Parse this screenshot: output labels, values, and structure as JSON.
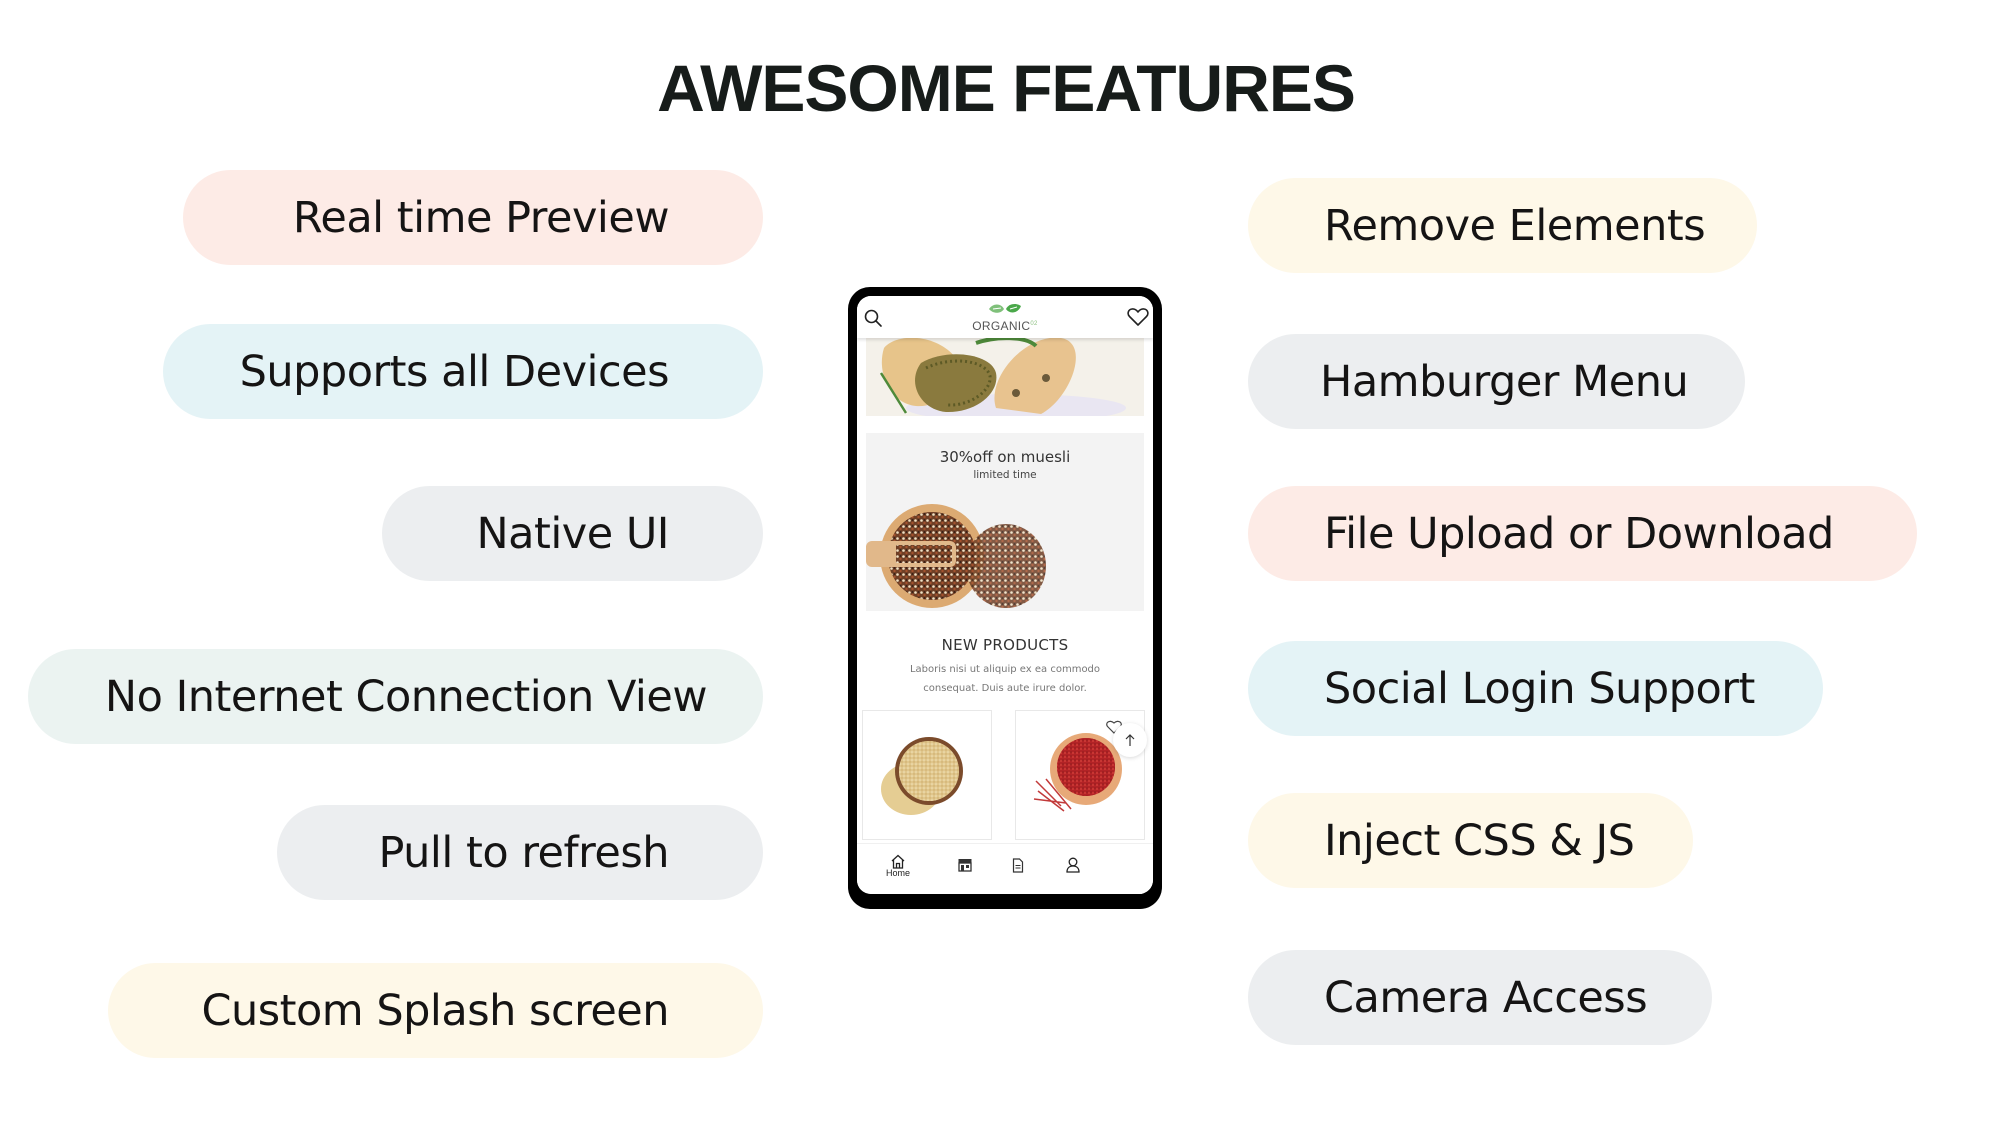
{
  "page": {
    "title": "AWESOME FEATURES"
  },
  "features_left": [
    {
      "label": "Real time Preview",
      "color": "#fdebe6"
    },
    {
      "label": "Supports all Devices",
      "color": "#e4f3f6"
    },
    {
      "label": "Native UI",
      "color": "#eceef0"
    },
    {
      "label": "No Internet Connection View",
      "color": "#ebf3f1"
    },
    {
      "label": "Pull to refresh",
      "color": "#eceef0"
    },
    {
      "label": "Custom Splash screen",
      "color": "#fef8e8"
    }
  ],
  "features_right": [
    {
      "label": "Remove Elements",
      "color": "#fef8e8"
    },
    {
      "label": "Hamburger Menu",
      "color": "#eceef0"
    },
    {
      "label": "File Upload or Download",
      "color": "#fdebe6"
    },
    {
      "label": "Social Login Support",
      "color": "#e4f3f6"
    },
    {
      "label": "Inject CSS & JS",
      "color": "#fef8e8"
    },
    {
      "label": "Camera Access",
      "color": "#eceef0"
    }
  ],
  "phone": {
    "logo_text": "ORGANIC",
    "logo_suffix": "02",
    "header_icons": [
      "search-icon",
      "heart-icon"
    ],
    "promo": {
      "headline": "30%off on muesli",
      "subline": "limited time"
    },
    "new_products": {
      "heading": "NEW PRODUCTS",
      "description": "Laboris nisi ut aliquip ex ea commodo consequat. Duis aute irure dolor."
    },
    "products": [
      {
        "image": "quinoa-bowl"
      },
      {
        "image": "saffron-bowl"
      }
    ],
    "scroll_top_icon": "arrow-up-icon",
    "tabs": [
      {
        "icon": "home-icon",
        "label": "Home"
      },
      {
        "icon": "store-icon",
        "label": ""
      },
      {
        "icon": "document-icon",
        "label": ""
      },
      {
        "icon": "user-icon",
        "label": ""
      }
    ]
  }
}
